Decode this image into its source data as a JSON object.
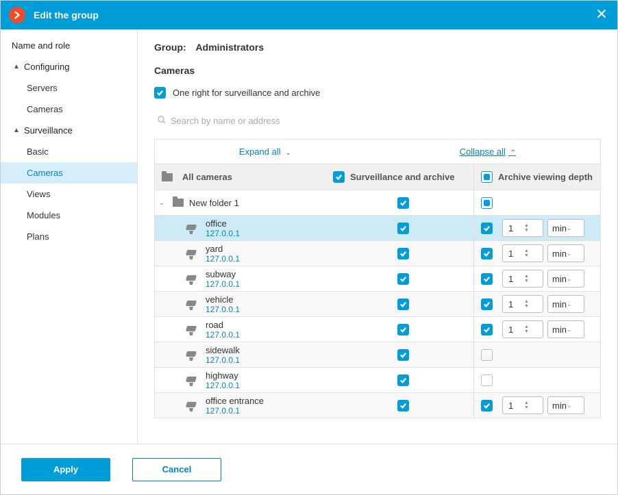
{
  "title": "Edit the group",
  "sidebar": {
    "name_role": "Name and role",
    "configuring": "Configuring",
    "servers": "Servers",
    "cameras_cfg": "Cameras",
    "surveillance": "Surveillance",
    "basic": "Basic",
    "cameras": "Cameras",
    "views": "Views",
    "modules": "Modules",
    "plans": "Plans"
  },
  "main": {
    "group_label": "Group:",
    "group_name": "Administrators",
    "section": "Cameras",
    "one_right": "One right for surveillance and archive",
    "search_placeholder": "Search by name or address",
    "expand_all": "Expand all",
    "collapse_all": "Collapse all",
    "col_all": "All cameras",
    "col_surv": "Surveillance and archive",
    "col_arch": "Archive viewing depth",
    "folder": "New folder 1",
    "unit": "min",
    "cameras": [
      {
        "name": "office",
        "ip": "127.0.0.1",
        "surv": true,
        "arch": true,
        "val": "1",
        "sel": true
      },
      {
        "name": "yard",
        "ip": "127.0.0.1",
        "surv": true,
        "arch": true,
        "val": "1"
      },
      {
        "name": "subway",
        "ip": "127.0.0.1",
        "surv": true,
        "arch": true,
        "val": "1"
      },
      {
        "name": "vehicle",
        "ip": "127.0.0.1",
        "surv": true,
        "arch": true,
        "val": "1"
      },
      {
        "name": "road",
        "ip": "127.0.0.1",
        "surv": true,
        "arch": true,
        "val": "1"
      },
      {
        "name": "sidewalk",
        "ip": "127.0.0.1",
        "surv": true,
        "arch": false
      },
      {
        "name": "highway",
        "ip": "127.0.0.1",
        "surv": true,
        "arch": false
      },
      {
        "name": "office entrance",
        "ip": "127.0.0.1",
        "surv": true,
        "arch": true,
        "val": "1"
      }
    ]
  },
  "footer": {
    "apply": "Apply",
    "cancel": "Cancel"
  }
}
